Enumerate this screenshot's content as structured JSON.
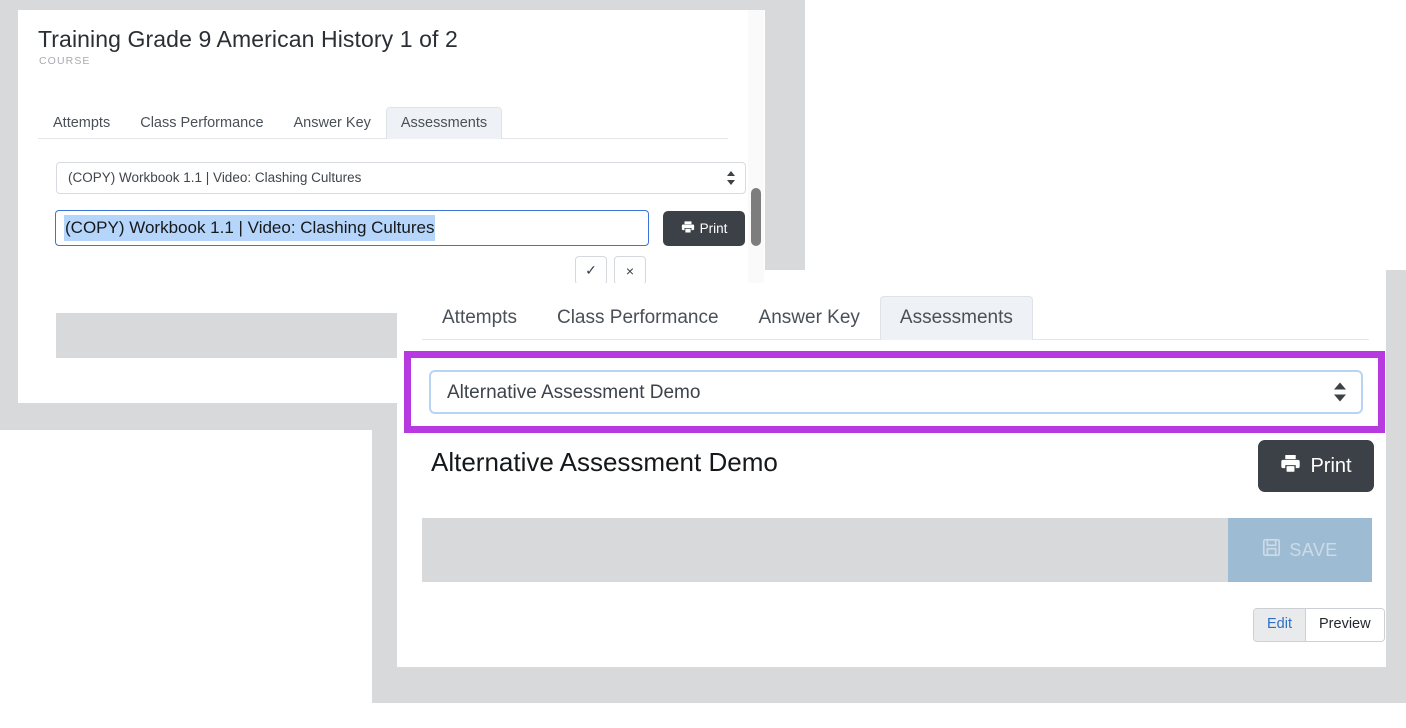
{
  "colors": {
    "highlight_ring": "#b63ae0",
    "page_bg": "#ffffff",
    "sheet_gray": "#d8d9db",
    "print_button": "#3c4148",
    "save_disabled": "#9dbbd2",
    "text_selection": "#b6d5fb",
    "input_focus_border": "#3b74d6",
    "select_focus_border": "#b8d4f5",
    "active_tab_bg": "#eef2f6",
    "link_blue": "#2f6fc4"
  },
  "top_card": {
    "title": "Training Grade 9 American History 1 of 2",
    "kicker": "COURSE",
    "tabs": [
      {
        "label": "Attempts",
        "active": false
      },
      {
        "label": "Class Performance",
        "active": false
      },
      {
        "label": "Answer Key",
        "active": false
      },
      {
        "label": "Assessments",
        "active": true
      }
    ],
    "assessment_select": {
      "value": "(COPY) Workbook 1.1 | Video: Clashing Cultures",
      "arrow_icon": "updown-arrows-icon"
    },
    "name_input": {
      "value": "(COPY) Workbook 1.1 | Video: Clashing Cultures",
      "selected": true
    },
    "print_button": {
      "label": "Print",
      "icon": "printer-icon"
    },
    "confirm_button": {
      "label": "✓",
      "icon": "check-icon"
    },
    "cancel_button": {
      "label": "×",
      "icon": "close-icon"
    }
  },
  "scrollbar": {
    "orientation": "vertical",
    "name": "vertical-scrollbar"
  },
  "bottom_card": {
    "tabs": [
      {
        "label": "Attempts",
        "active": false
      },
      {
        "label": "Class Performance",
        "active": false
      },
      {
        "label": "Answer Key",
        "active": false
      },
      {
        "label": "Assessments",
        "active": true
      }
    ],
    "assessment_select": {
      "value": "Alternative Assessment Demo",
      "arrow_icon": "updown-arrows-icon"
    },
    "heading": "Alternative Assessment Demo",
    "print_button": {
      "label": "Print",
      "icon": "printer-icon"
    },
    "save_button": {
      "label": "SAVE",
      "icon": "floppy-disk-icon",
      "disabled": true
    },
    "view_toggle": {
      "options": [
        {
          "label": "Edit",
          "selected": true
        },
        {
          "label": "Preview",
          "selected": false
        }
      ]
    }
  }
}
